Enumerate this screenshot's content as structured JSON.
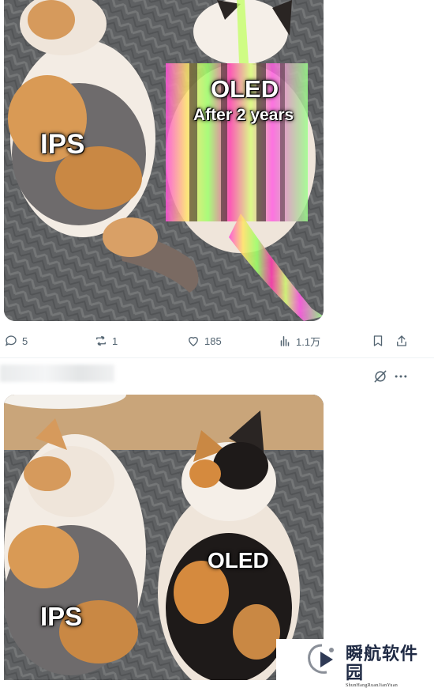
{
  "post1": {
    "labels": {
      "ips": "IPS",
      "oled": "OLED",
      "oled_sub": "After 2 years"
    },
    "actions": {
      "replies": "5",
      "reposts": "1",
      "likes": "185",
      "views": "1.1万"
    }
  },
  "post2": {
    "labels": {
      "oled": "OLED",
      "ips": "IPS"
    }
  },
  "watermark": {
    "chinese": "瞬航软件园",
    "pinyin": "ShunHangRuanJianYuan"
  },
  "colors": {
    "icon": "#536471",
    "divider": "#eff3f4"
  }
}
